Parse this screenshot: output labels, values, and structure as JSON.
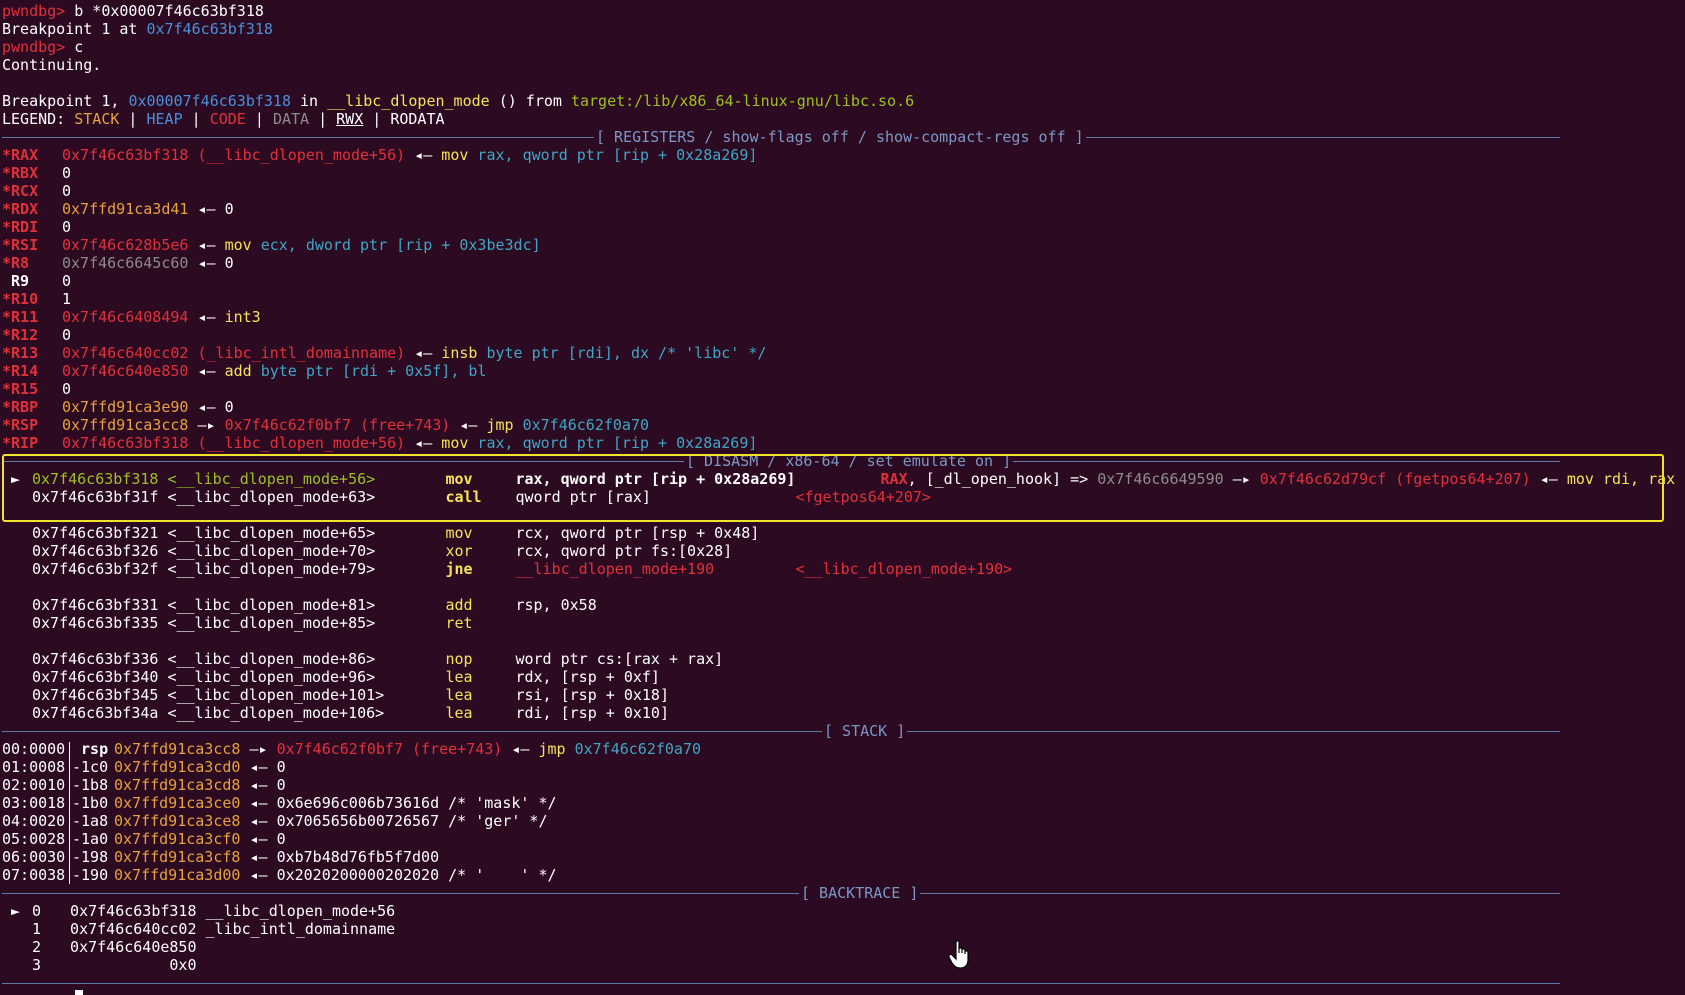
{
  "session": [
    {
      "prompt": "pwndbg> ",
      "cmd": "b *0x00007f46c63bf318"
    },
    {
      "text": "Breakpoint 1 at ",
      "addr": "0x7f46c63bf318"
    },
    {
      "prompt": "pwndbg> ",
      "cmd": "c"
    },
    {
      "text": "Continuing."
    },
    {
      "text": ""
    },
    {
      "bp_prefix": "Breakpoint 1, ",
      "bp_addr": "0x00007f46c63bf318",
      "bp_in": " in ",
      "bp_func": "__libc_dlopen_mode",
      "bp_from": " () from ",
      "bp_lib": "target:/lib/x86_64-linux-gnu/libc.so.6"
    }
  ],
  "legend": {
    "label": "LEGEND: ",
    "items": [
      "STACK",
      "HEAP",
      "CODE",
      "DATA",
      "RWX",
      "RODATA"
    ],
    "sep": " | "
  },
  "sections": {
    "registers": "[ REGISTERS / show-flags off / show-compact-regs off ]",
    "disasm": "[ DISASM / x86-64 / set emulate on ]",
    "stack": "[ STACK ]",
    "backtrace": "[ BACKTRACE ]"
  },
  "registers": [
    {
      "name": "*RAX",
      "v1": "0x7f46c63bf318 (__libc_dlopen_mode+56)",
      "arrow": " ◂— ",
      "ins": "mov",
      "ops": "rax, qword ptr [rip + 0x28a269]"
    },
    {
      "name": "*RBX",
      "v1": "0"
    },
    {
      "name": "*RCX",
      "v1": "0"
    },
    {
      "name": "*RDX",
      "v1": "0x7ffd91ca3d41",
      "arrow": " ◂— ",
      "rest": "0"
    },
    {
      "name": "*RDI",
      "v1": "0"
    },
    {
      "name": "*RSI",
      "v1": "0x7f46c628b5e6",
      "arrow": " ◂— ",
      "ins": "mov",
      "ops": "ecx, dword ptr [rip + 0x3be3dc]"
    },
    {
      "name": "*R8",
      "v1": "0x7f46c6645c60",
      "arrow": " ◂— ",
      "rest": "0"
    },
    {
      "name": " R9",
      "v1": "0"
    },
    {
      "name": "*R10",
      "v1": "1"
    },
    {
      "name": "*R11",
      "v1": "0x7f46c6408494",
      "arrow": " ◂— ",
      "ins": "int3"
    },
    {
      "name": "*R12",
      "v1": "0"
    },
    {
      "name": "*R13",
      "v1": "0x7f46c640cc02 (_libc_intl_domainname)",
      "arrow": " ◂— ",
      "ins": "insb",
      "ops": "byte ptr [rdi], dx /* 'libc' */"
    },
    {
      "name": "*R14",
      "v1": "0x7f46c640e850",
      "arrow": " ◂— ",
      "ins": "add",
      "ops": "byte ptr [rdi + 0x5f], bl"
    },
    {
      "name": "*R15",
      "v1": "0"
    },
    {
      "name": "*RBP",
      "v1": "0x7ffd91ca3e90",
      "arrow": " ◂— ",
      "rest": "0"
    },
    {
      "name": "*RSP",
      "v1": "0x7ffd91ca3cc8",
      "arrow": " —▸ ",
      "v2": "0x7f46c62f0bf7 (free+743)",
      "arrow2": " ◂— ",
      "ins": "jmp",
      "ops": "0x7f46c62f0a70"
    },
    {
      "name": "*RIP",
      "v1": "0x7f46c63bf318 (__libc_dlopen_mode+56)",
      "arrow": " ◂— ",
      "ins": "mov",
      "ops": "rax, qword ptr [rip + 0x28a269]"
    }
  ],
  "disasm": [
    {
      "mark": " ► ",
      "addr": "0x7f46c63bf318",
      "sym": "<__libc_dlopen_mode+56>",
      "ins": "mov",
      "ops": "rax, qword ptr [rip + 0x28a269]",
      "c1": "RAX",
      "c2": ", [_dl_open_hook] => ",
      "c3": "0x7f46c6649590",
      "c4": " —▸ ",
      "c5": "0x7f46c62d79cf (fgetpos64+207)",
      "c6": " ◂— ",
      "c7": "mov rdi, rax"
    },
    {
      "mark": "   ",
      "addr": "0x7f46c63bf31f",
      "sym": "<__libc_dlopen_mode+63>",
      "ins": "call",
      "ops": "qword ptr [rax]",
      "c8": "<fgetpos64+207>"
    },
    {
      "blank": true
    },
    {
      "mark": "   ",
      "addr": "0x7f46c63bf321",
      "sym": "<__libc_dlopen_mode+65>",
      "ins": "mov",
      "ops": "rcx, qword ptr [rsp + 0x48]"
    },
    {
      "mark": "   ",
      "addr": "0x7f46c63bf326",
      "sym": "<__libc_dlopen_mode+70>",
      "ins": "xor",
      "ops": "rcx, qword ptr fs:[0x28]"
    },
    {
      "mark": "   ",
      "addr": "0x7f46c63bf32f",
      "sym": "<__libc_dlopen_mode+79>",
      "ins": "jne",
      "ops": "__libc_dlopen_mode+190",
      "c9": "<__libc_dlopen_mode+190>"
    },
    {
      "blank": true
    },
    {
      "mark": "   ",
      "addr": "0x7f46c63bf331",
      "sym": "<__libc_dlopen_mode+81>",
      "ins": "add",
      "ops": "rsp, 0x58"
    },
    {
      "mark": "   ",
      "addr": "0x7f46c63bf335",
      "sym": "<__libc_dlopen_mode+85>",
      "ins": "ret",
      "ops": ""
    },
    {
      "blank": true
    },
    {
      "mark": "   ",
      "addr": "0x7f46c63bf336",
      "sym": "<__libc_dlopen_mode+86>",
      "ins": "nop",
      "ops": "word ptr cs:[rax + rax]"
    },
    {
      "mark": "   ",
      "addr": "0x7f46c63bf340",
      "sym": "<__libc_dlopen_mode+96>",
      "ins": "lea",
      "ops": "rdx, [rsp + 0xf]"
    },
    {
      "mark": "   ",
      "addr": "0x7f46c63bf345",
      "sym": "<__libc_dlopen_mode+101>",
      "ins": "lea",
      "ops": "rsi, [rsp + 0x18]"
    },
    {
      "mark": "   ",
      "addr": "0x7f46c63bf34a",
      "sym": "<__libc_dlopen_mode+106>",
      "ins": "lea",
      "ops": "rdi, [rsp + 0x10]"
    }
  ],
  "stack": [
    {
      "idx": "00:0000",
      "off": " rsp",
      "addr": "0x7ffd91ca3cc8",
      "arrow": " —▸ ",
      "v": "0x7f46c62f0bf7 (free+743)",
      "arrow2": " ◂— ",
      "ins": "jmp",
      "ops": "0x7f46c62f0a70"
    },
    {
      "idx": "01:0008",
      "off": "-1c0",
      "addr": "0x7ffd91ca3cd0",
      "arrow": " ◂— ",
      "rest": "0"
    },
    {
      "idx": "02:0010",
      "off": "-1b8",
      "addr": "0x7ffd91ca3cd8",
      "arrow": " ◂— ",
      "rest": "0"
    },
    {
      "idx": "03:0018",
      "off": "-1b0",
      "addr": "0x7ffd91ca3ce0",
      "arrow": " ◂— ",
      "rest": "0x6e696c006b73616d /* 'mask' */"
    },
    {
      "idx": "04:0020",
      "off": "-1a8",
      "addr": "0x7ffd91ca3ce8",
      "arrow": " ◂— ",
      "rest": "0x7065656b00726567 /* 'ger' */"
    },
    {
      "idx": "05:0028",
      "off": "-1a0",
      "addr": "0x7ffd91ca3cf0",
      "arrow": " ◂— ",
      "rest": "0"
    },
    {
      "idx": "06:0030",
      "off": "-198",
      "addr": "0x7ffd91ca3cf8",
      "arrow": " ◂— ",
      "rest": "0xb7b48d76fb5f7d00"
    },
    {
      "idx": "07:0038",
      "off": "-190",
      "addr": "0x7ffd91ca3d00",
      "arrow": " ◂— ",
      "rest": "0x2020200000202020 /* '    ' */"
    }
  ],
  "backtrace": [
    {
      "mark": " ► ",
      "n": "0",
      "addr": "  0x7f46c63bf318",
      "sym": " __libc_dlopen_mode+56"
    },
    {
      "mark": "   ",
      "n": "1",
      "addr": "  0x7f46c640cc02",
      "sym": " _libc_intl_domainname"
    },
    {
      "mark": "   ",
      "n": "2",
      "addr": "  0x7f46c640e850",
      "sym": ""
    },
    {
      "mark": "   ",
      "n": "3",
      "addr": "             0x0",
      "sym": ""
    }
  ],
  "colors": {
    "background": "#2c0a22",
    "highlight_border": "#f0e32a",
    "rule": "#5e7ba8"
  }
}
